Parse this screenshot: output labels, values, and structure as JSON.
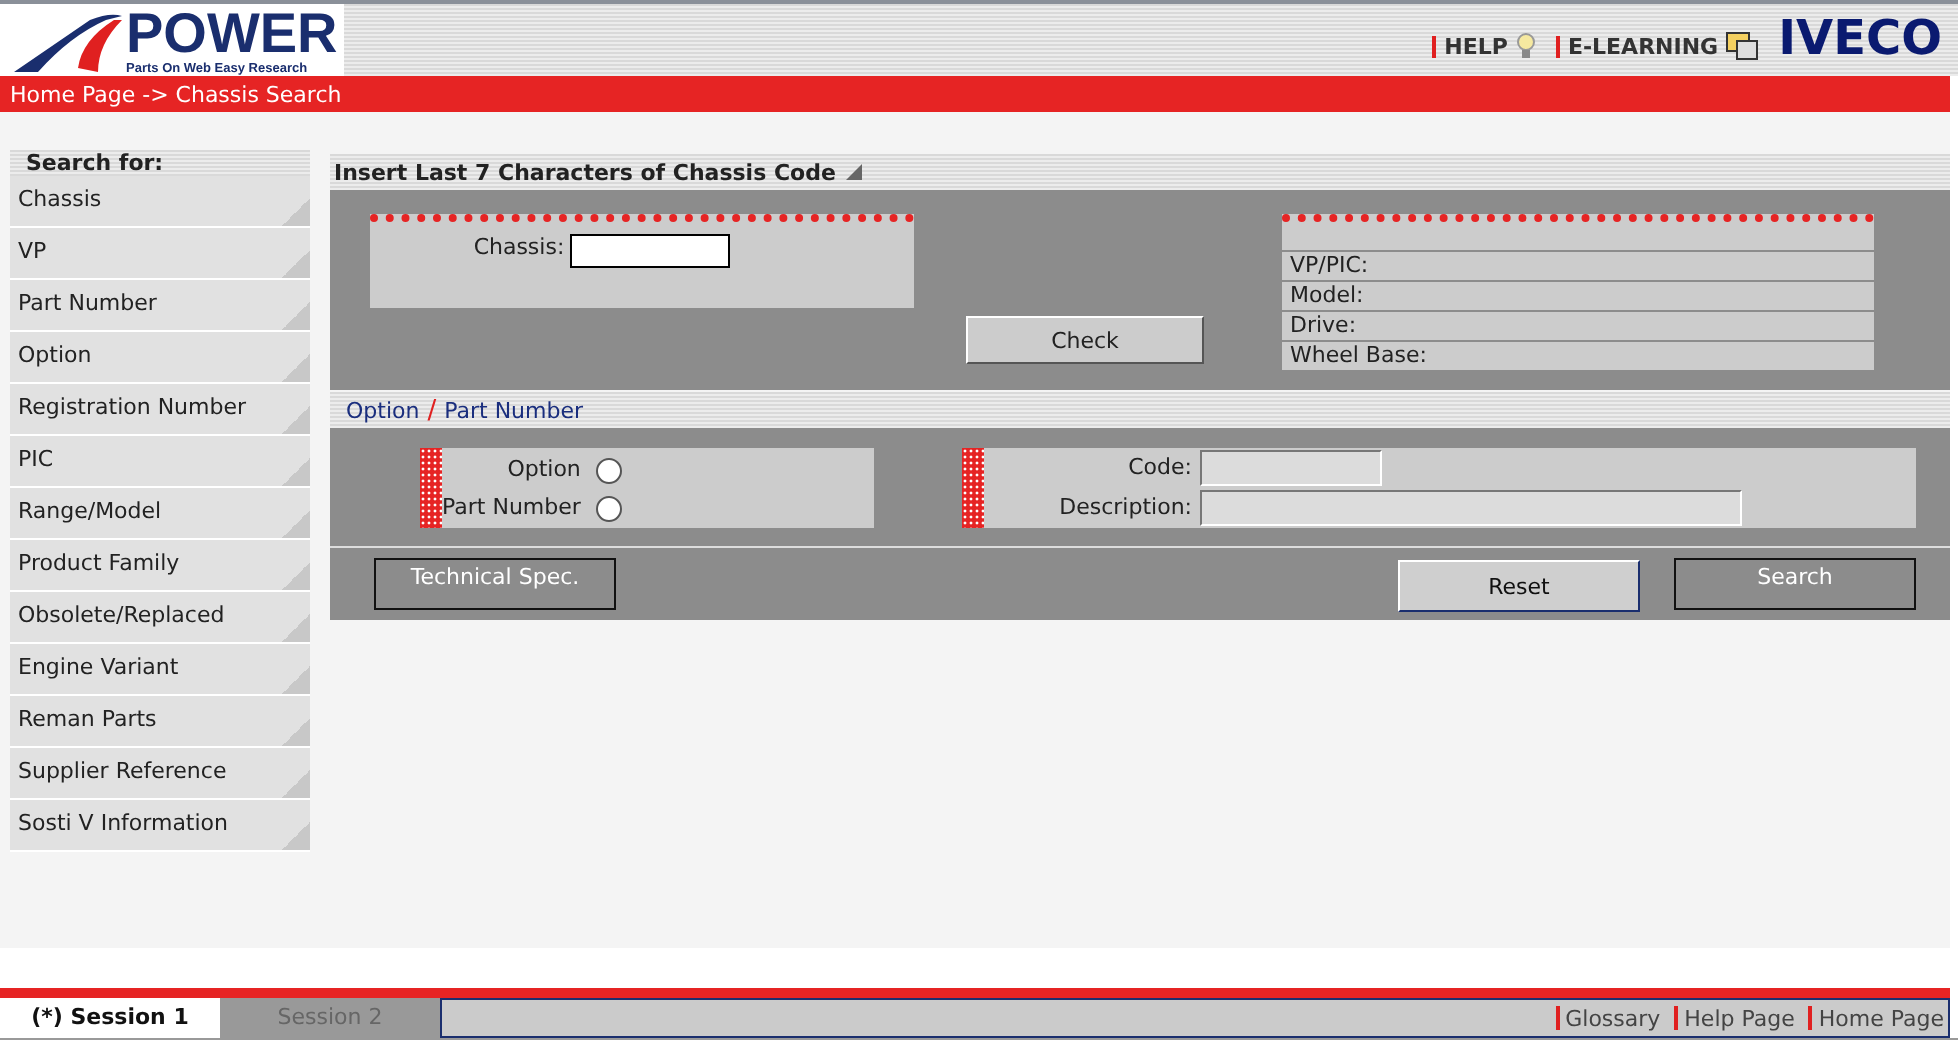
{
  "header": {
    "logo_title": "POWER",
    "logo_subtitle": "Parts On Web Easy Research",
    "links": [
      {
        "label": "HELP",
        "kind": "bulb"
      },
      {
        "label": "E-LEARNING",
        "kind": "window"
      }
    ],
    "brand": "IVECO"
  },
  "breadcrumb": "Home Page -> Chassis Search",
  "sidebar": {
    "title": "Search for:",
    "items": [
      "Chassis",
      "VP",
      "Part Number",
      "Option",
      "Registration Number",
      "PIC",
      "Range/Model",
      "Product Family",
      "Obsolete/Replaced",
      "Engine Variant",
      "Reman Parts",
      "Supplier Reference",
      "Sosti V Information"
    ]
  },
  "chassis_section": {
    "title": "Insert Last 7 Characters of Chassis Code",
    "chassis_label": "Chassis:",
    "check_button": "Check",
    "info_fields": [
      "VP/PIC:",
      "Model:",
      "Drive:",
      "Wheel Base:"
    ]
  },
  "option_section": {
    "title_parts": [
      "Option",
      "Part Number"
    ],
    "separator": "/",
    "radios": [
      {
        "label": "Option",
        "selected": false
      },
      {
        "label": "Part Number",
        "selected": false
      }
    ],
    "fields": [
      {
        "label": "Code:",
        "kind": "short"
      },
      {
        "label": "Description:",
        "kind": "long"
      }
    ]
  },
  "buttons": [
    {
      "label": "Technical Spec.",
      "kind": "dark"
    },
    {
      "label": "Reset",
      "kind": "light"
    },
    {
      "label": "Search",
      "kind": "dark"
    }
  ],
  "footer": {
    "tabs": [
      {
        "label": "(*) Session 1",
        "selected": true
      },
      {
        "label": "Session 2",
        "selected": false
      }
    ],
    "links": [
      "Glossary",
      "Help Page",
      "Home Page"
    ]
  }
}
